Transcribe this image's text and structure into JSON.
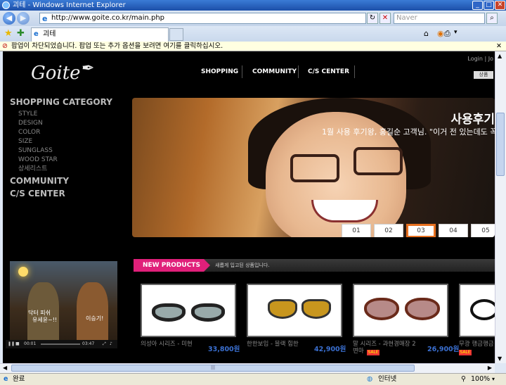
{
  "window": {
    "title": "괴테 - Windows Internet Explorer",
    "minimize": "_",
    "maximize": "□",
    "close": "✕"
  },
  "nav": {
    "back": "◀",
    "forward": "▶",
    "url": "http://www.goite.co.kr/main.php",
    "search_placeholder": "Naver"
  },
  "tab": {
    "label": "괴테"
  },
  "popup_bar": {
    "text": "팝업이 차단되었습니다. 팝업 또는 추가 옵션을 보려면 여기를 클릭하십시오."
  },
  "site": {
    "logo": "Goite",
    "top_nav": [
      "SHOPPING",
      "COMMUNITY",
      "C/S CENTER"
    ],
    "login": "Login | Jo",
    "search_label": "상품",
    "category": {
      "heading": "SHOPPING CATEGORY",
      "items": [
        "STYLE",
        "DESIGN",
        "COLOR",
        "SIZE",
        "SUNGLASS",
        "WOOD STAR",
        "상세리스트"
      ],
      "community": "COMMUNITY",
      "cs_center": "C/S CENTER"
    },
    "banner": {
      "title": "사용후기",
      "subtitle": "1월 사용 후기왕, 홍길순 고객님. \"이거 전 있는데도 꼭",
      "pages": [
        "01",
        "02",
        "03",
        "04",
        "05"
      ],
      "active_page": "03"
    },
    "video": {
      "captions": [
        "닥터 피쉬",
        "유세윤~!!",
        "이승기!"
      ],
      "time_current": "00:01",
      "time_total": "03:47"
    },
    "new_products": {
      "label": "NEW PRODUCTS",
      "subtitle": "새롭게 입고된 상품입니다.",
      "items": [
        {
          "name": "의성아 시리즈 - 미현",
          "price": "33,800원",
          "sale": false
        },
        {
          "name": "한한보임 - 블랙 힘한",
          "price": "42,900원",
          "sale": false
        },
        {
          "name": "말 시리즈 - 과현경매장 2 변마",
          "price": "26,900원",
          "sale": true
        },
        {
          "name": "무광 행금행금",
          "price": "",
          "sale": true
        }
      ],
      "sale_badge": "SALE"
    }
  },
  "status": {
    "text": "완료",
    "zone": "인터넷",
    "zoom": "100%"
  }
}
